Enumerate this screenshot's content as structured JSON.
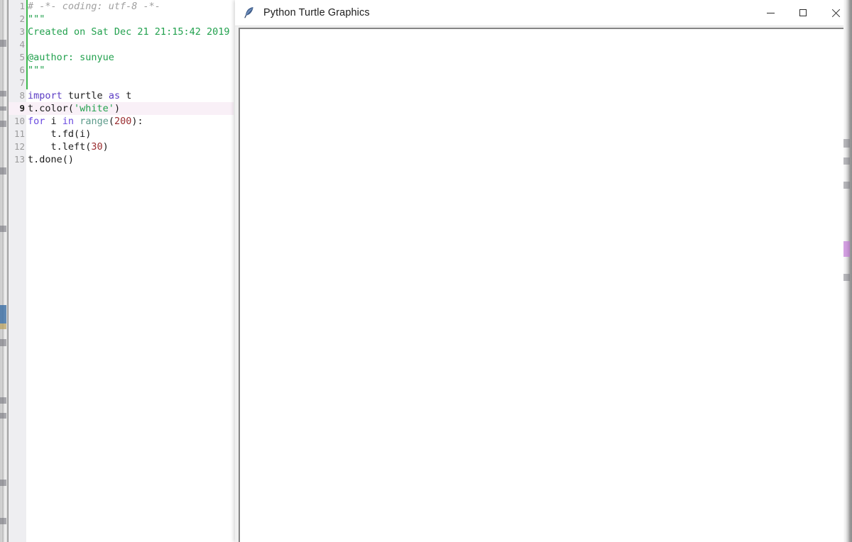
{
  "desktop": {
    "left_strip_label": "occluded-window-edge",
    "right_strip_label": "occluded-window-edge"
  },
  "editor": {
    "name": "python-code-editor",
    "current_line": 9,
    "gutter_visible": true,
    "colors": {
      "background": "#ffffff",
      "gutter": "#eeeef1",
      "current_line_highlight": "#f9f0f7",
      "change_bar": "#3fb950",
      "comment": "#a0a0a0",
      "string": "#22a14e",
      "keyword": "#5b3cc4",
      "builtin": "#5d9b8b",
      "number": "#9b2d30",
      "plain": "#1c1c1c"
    },
    "lines": [
      {
        "num": "1",
        "tokens": [
          {
            "t": "# -*- coding: utf-8 -*-",
            "c": "tk-comment"
          }
        ]
      },
      {
        "num": "2",
        "tokens": [
          {
            "t": "\"\"\"",
            "c": "tk-doc"
          }
        ]
      },
      {
        "num": "3",
        "tokens": [
          {
            "t": "Created on Sat Dec 21 21:15:42 2019",
            "c": "tk-doc"
          }
        ]
      },
      {
        "num": "4",
        "tokens": [
          {
            "t": "",
            "c": "tk-doc"
          }
        ]
      },
      {
        "num": "5",
        "tokens": [
          {
            "t": "@author: sunyue",
            "c": "tk-doc"
          }
        ]
      },
      {
        "num": "6",
        "tokens": [
          {
            "t": "\"\"\"",
            "c": "tk-doc"
          }
        ]
      },
      {
        "num": "7",
        "tokens": [
          {
            "t": "",
            "c": "tk-plain"
          }
        ]
      },
      {
        "num": "8",
        "tokens": [
          {
            "t": "import",
            "c": "tk-kw"
          },
          {
            "t": " turtle ",
            "c": "tk-plain"
          },
          {
            "t": "as",
            "c": "tk-kw"
          },
          {
            "t": " t",
            "c": "tk-plain"
          }
        ]
      },
      {
        "num": "9",
        "current": true,
        "tokens": [
          {
            "t": "t.color(",
            "c": "tk-plain"
          },
          {
            "t": "'white'",
            "c": "tk-string"
          },
          {
            "t": ")",
            "c": "tk-plain"
          }
        ]
      },
      {
        "num": "10",
        "tokens": [
          {
            "t": "for",
            "c": "tk-kw2"
          },
          {
            "t": " i ",
            "c": "tk-plain"
          },
          {
            "t": "in",
            "c": "tk-kw2"
          },
          {
            "t": " ",
            "c": "tk-plain"
          },
          {
            "t": "range",
            "c": "tk-builtin"
          },
          {
            "t": "(",
            "c": "tk-plain"
          },
          {
            "t": "200",
            "c": "tk-num"
          },
          {
            "t": "):",
            "c": "tk-plain"
          }
        ]
      },
      {
        "num": "11",
        "tokens": [
          {
            "t": "    t.fd(i)",
            "c": "tk-plain"
          }
        ]
      },
      {
        "num": "12",
        "tokens": [
          {
            "t": "    t.left(",
            "c": "tk-plain"
          },
          {
            "t": "30",
            "c": "tk-num"
          },
          {
            "t": ")",
            "c": "tk-plain"
          }
        ]
      },
      {
        "num": "13",
        "tokens": [
          {
            "t": "t.done()",
            "c": "tk-plain"
          }
        ]
      }
    ]
  },
  "turtle_window": {
    "title": "Python Turtle Graphics",
    "icon": "feather-quill-icon",
    "controls": {
      "minimize_label": "Minimize",
      "maximize_label": "Maximize",
      "close_label": "Close"
    },
    "canvas": {
      "name": "turtle-drawing-canvas",
      "background": "#ffffff",
      "content": "blank"
    }
  }
}
